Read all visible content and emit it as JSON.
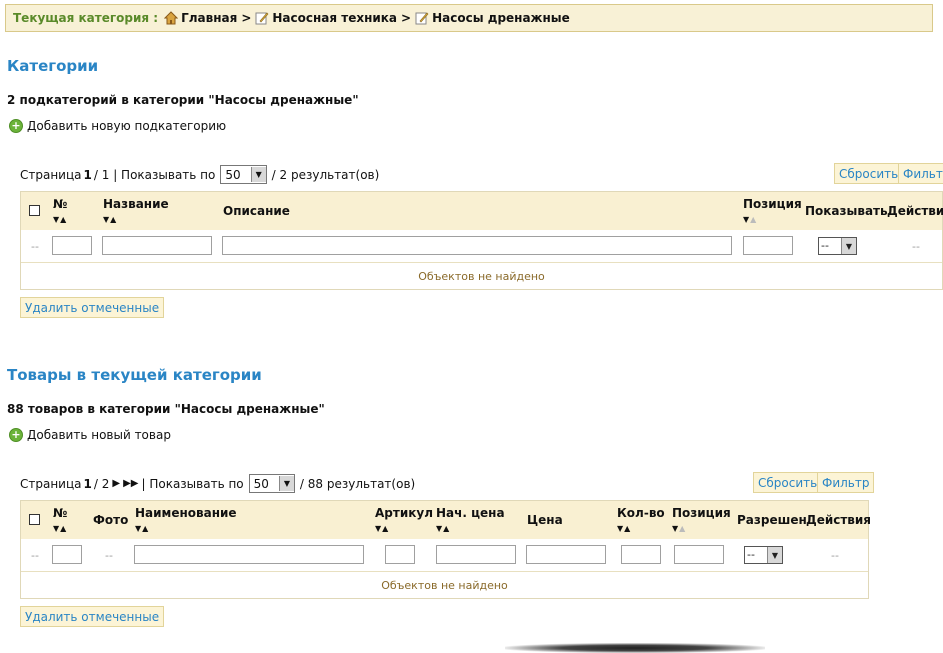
{
  "breadcrumb": {
    "label": "Текущая категория :",
    "items": [
      "Главная",
      "Насосная техника",
      "Насосы дренажные"
    ],
    "sep": ">"
  },
  "categories": {
    "title": "Категории",
    "info": "2 подкатегорий в категории \"Насосы дренажные\"",
    "add_label": "Добавить новую подкатегорию",
    "pager": {
      "prefix": "Страница",
      "page": "1",
      "of": "/ 1",
      "show": "| Показывать по",
      "per_page": "50",
      "results": "/ 2 результат(ов)"
    },
    "reset_btn": "Сбросить",
    "filter_btn": "Фильтр",
    "columns": {
      "num": "№",
      "name": "Название",
      "desc": "Описание",
      "pos": "Позиция",
      "show": "Показывать",
      "actions": "Действия"
    },
    "filter_select": "--",
    "dash": "--",
    "empty": "Объектов не найдено",
    "delete_btn": "Удалить отмеченные"
  },
  "products": {
    "title": "Товары в текущей категории",
    "info": "88 товаров в категории \"Насосы дренажные\"",
    "add_label": "Добавить новый товар",
    "pager": {
      "prefix": "Страница",
      "page": "1",
      "of": "/ 2",
      "show": "| Показывать по",
      "per_page": "50",
      "results": "/ 88 результат(ов)"
    },
    "reset_btn": "Сбросить",
    "filter_btn": "Фильтр",
    "columns": {
      "num": "№",
      "photo": "Фото",
      "name": "Наименование",
      "sku": "Артикул",
      "start_price": "Нач. цена",
      "price": "Цена",
      "qty": "Кол-во",
      "pos": "Позиция",
      "allowed": "Разрешен",
      "actions": "Действия"
    },
    "filter_select": "--",
    "dash": "--",
    "empty": "Объектов не найдено",
    "delete_btn": "Удалить отмеченные"
  }
}
